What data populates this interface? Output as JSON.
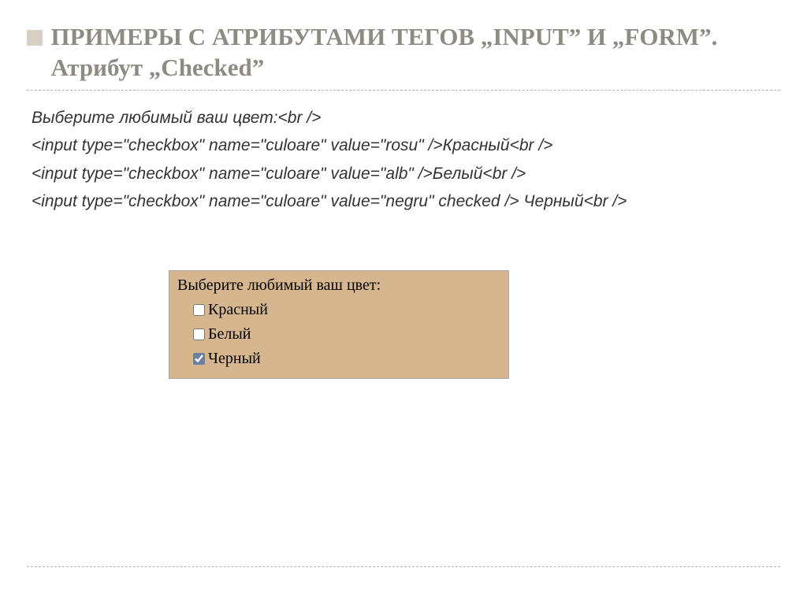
{
  "title": "ПРИМЕРЫ С АТРИБУТАМИ ТЕГОВ  „INPUT”  И „FORM”.  Атрибут „Checked”",
  "code": {
    "l1": "Выберите любимый ваш цвет:<br />",
    "l2": "<input type=\"checkbox\" name=\"culoare\" value=\"rosu\" />Красный<br />",
    "l3": "<input type=\"checkbox\" name=\"culoare\" value=\"alb\" />Белый<br />",
    "l4": "<input type=\"checkbox\" name=\"culoare\" value=\"negru\" checked  /> Черный<br />"
  },
  "example": {
    "prompt": "Выберите любимый ваш цвет:",
    "options": {
      "o1": {
        "label": "Красный",
        "checked": false
      },
      "o2": {
        "label": "Белый",
        "checked": false
      },
      "o3": {
        "label": "Черный",
        "checked": true
      }
    }
  }
}
